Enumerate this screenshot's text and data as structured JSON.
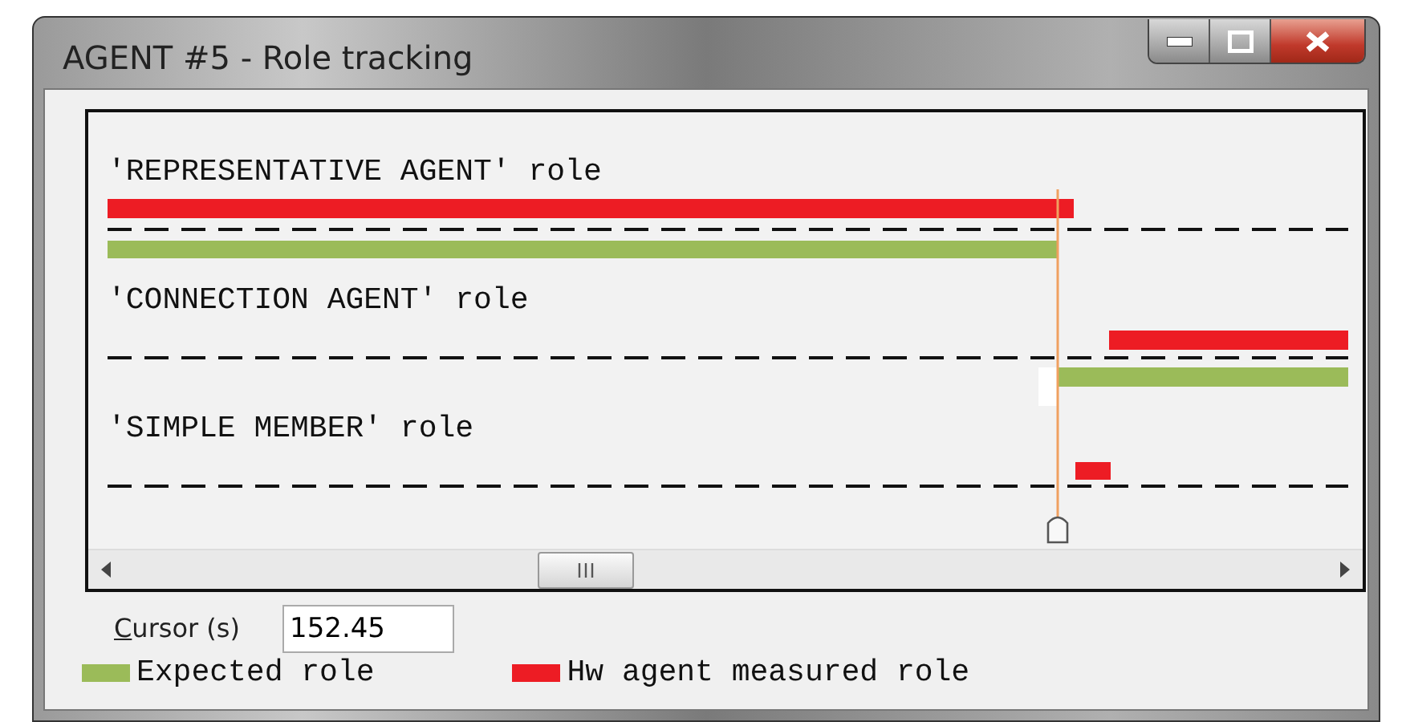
{
  "window": {
    "title": "AGENT #5 - Role tracking"
  },
  "tracks": [
    {
      "label": "'REPRESENTATIVE AGENT' role"
    },
    {
      "label": "'CONNECTION AGENT' role"
    },
    {
      "label": "'SIMPLE MEMBER' role"
    }
  ],
  "cursor": {
    "label": "Cursor (s)",
    "value": "152.45"
  },
  "legend": [
    {
      "label": "Expected role",
      "color": "#9bbb59"
    },
    {
      "label": "Hw agent measured role",
      "color": "#ed1c24"
    }
  ]
}
